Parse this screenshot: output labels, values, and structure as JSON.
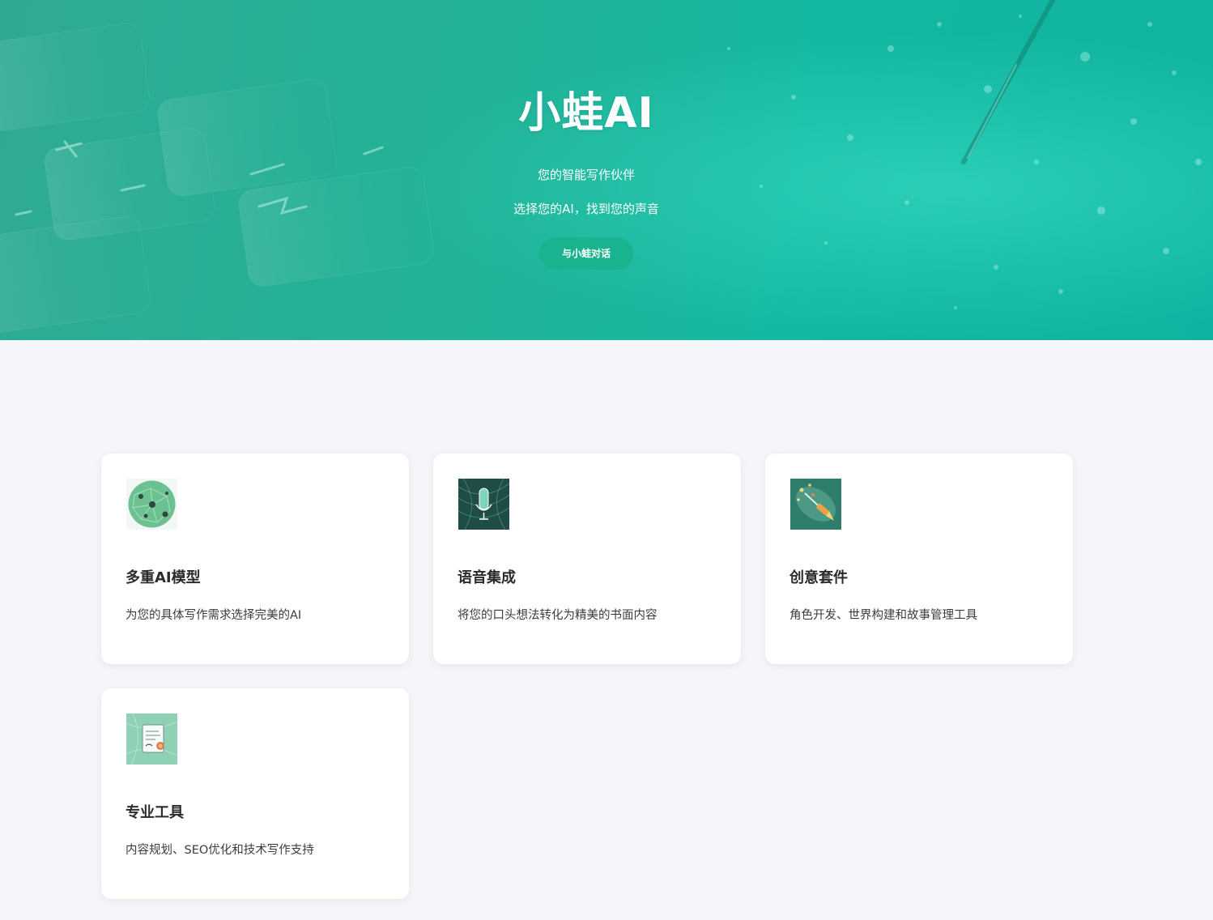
{
  "hero": {
    "title": "小蛙AI",
    "subtitle": "您的智能写作伙伴",
    "tagline": "选择您的AI，找到您的声音",
    "cta_label": "与小蛙对话"
  },
  "features": [
    {
      "icon": "globe-network-icon",
      "title": "多重AI模型",
      "description": "为您的具体写作需求选择完美的AI"
    },
    {
      "icon": "microphone-icon",
      "title": "语音集成",
      "description": "将您的口头想法转化为精美的书面内容"
    },
    {
      "icon": "creative-pen-icon",
      "title": "创意套件",
      "description": "角色开发、世界构建和故事管理工具"
    },
    {
      "icon": "document-seal-icon",
      "title": "专业工具",
      "description": "内容规划、SEO优化和技术写作支持"
    }
  ],
  "colors": {
    "hero_accent": "#14b8a0",
    "cta_button": "#19b38f",
    "page_background": "#f4f6f9",
    "card_background": "#ffffff",
    "title_text": "#2b2b2b"
  }
}
